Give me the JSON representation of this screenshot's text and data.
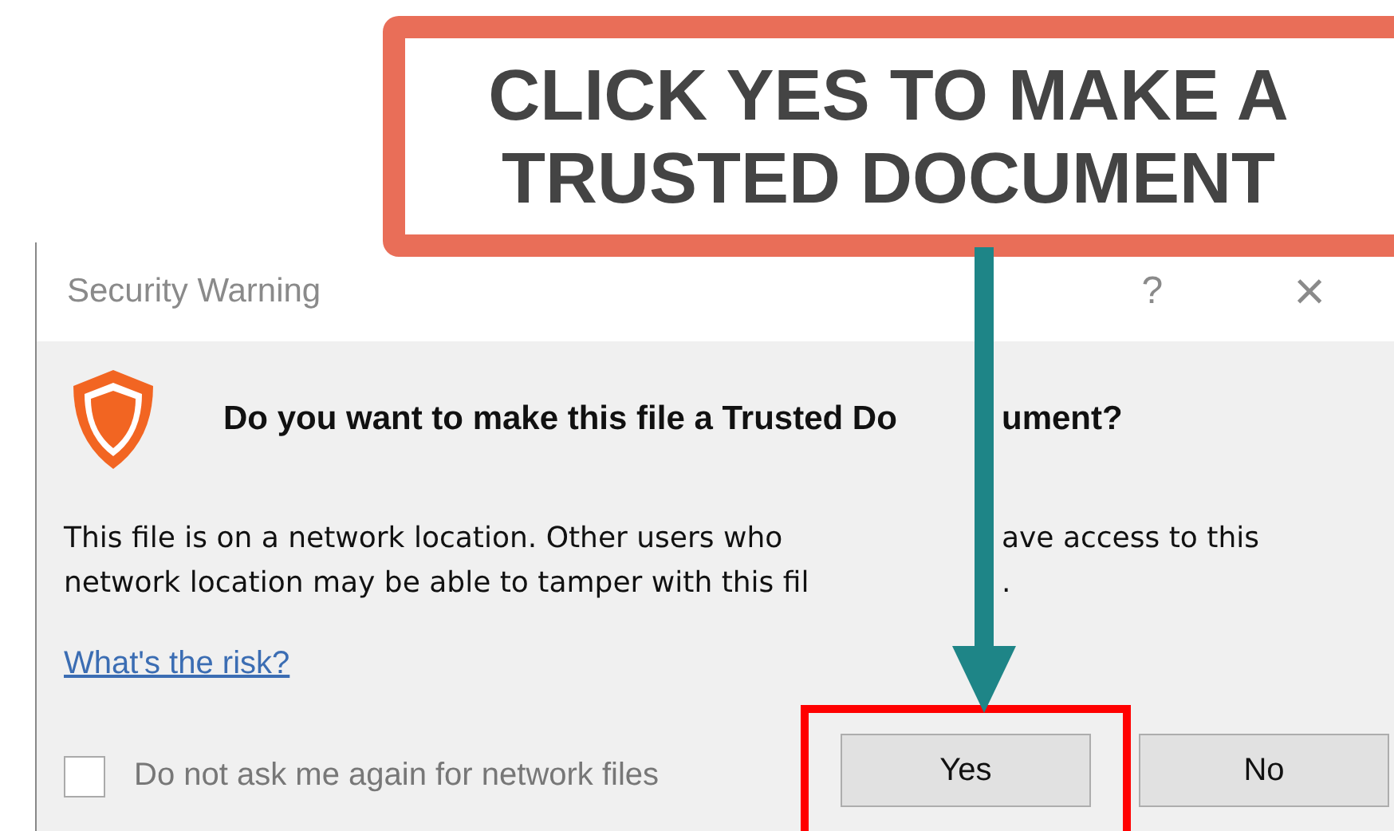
{
  "dialog": {
    "title": "Security Warning",
    "help": "?",
    "close": "×",
    "heading": {
      "before_arrow": "Do you want to make this file a Trusted Do",
      "after_arrow": "ument?"
    },
    "message_lines": [
      {
        "before_arrow": "This file is on a network location. Other users who",
        "after_arrow": "ave access to this"
      },
      {
        "before_arrow": "network location may be able to tamper with this fil",
        "after_arrow": "."
      }
    ],
    "link": "What's the risk?",
    "checkbox": {
      "label": "Do not ask me again for network files",
      "checked": false
    },
    "buttons": [
      {
        "label": "Yes",
        "highlighted": true
      },
      {
        "label": "No",
        "highlighted": false
      }
    ]
  },
  "callout": {
    "lines": [
      "CLICK YES TO MAKE A",
      "TRUSTED DOCUMENT"
    ]
  }
}
